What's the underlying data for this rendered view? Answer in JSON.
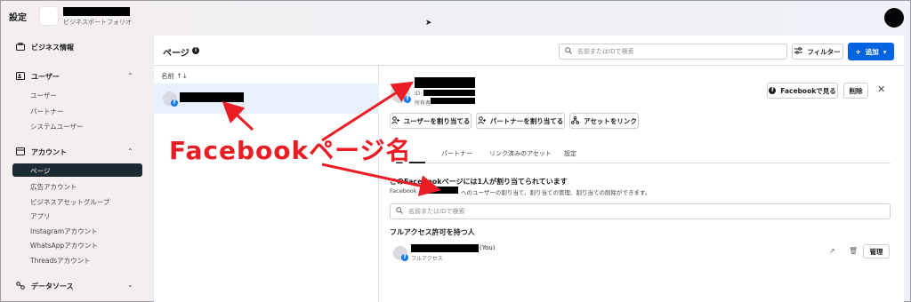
{
  "topbar": {
    "title": "設定",
    "portfolio_label": "ビジネスポートフォリオ"
  },
  "sidebar": {
    "business_info": "ビジネス情報",
    "users_group": "ユーザー",
    "users_items": [
      "ユーザー",
      "パートナー",
      "システムユーザー"
    ],
    "accounts_group": "アカウント",
    "accounts_items": [
      "ページ",
      "広告アカウント",
      "ビジネスアセットグループ",
      "アプリ",
      "Instagramアカウント",
      "WhatsAppアカウント",
      "Threadsアカウント"
    ],
    "datasources_group": "データソース",
    "active_item": "ページ"
  },
  "header": {
    "title": "ページ",
    "search_placeholder": "名前またはIDで検索",
    "filter_label": "フィルター",
    "add_label": "追加"
  },
  "list": {
    "column_header": "名前 ↑↓"
  },
  "detail": {
    "id_label": "ID:",
    "owner_label": "所有者:",
    "view_on_facebook": "Facebookで見る",
    "delete_label": "削除",
    "assign_user": "ユーザーを割り当てる",
    "assign_partner": "パートナーを割り当てる",
    "link_asset": "アセットをリンク",
    "tabs": [
      "パートナー",
      "リンク済みのアセット",
      "設定"
    ],
    "section_title": "このFacebookページには1人が割り当てられています",
    "section_desc_prefix": "Facebook",
    "section_desc_suffix": "へのユーザーの割り当て、割り当ての管理、割り当ての削除ができます。",
    "search_placeholder": "名前またはIDで検索",
    "full_access_heading": "フルアクセス許可を持つ人",
    "person_you": "(You)",
    "person_role": "フルアクセス",
    "manage_label": "管理"
  },
  "annotation": {
    "text": "Facebookページ名",
    "color": "#ea1d24"
  },
  "colors": {
    "primary": "#0064e0",
    "sidebar_active": "#1c2b33",
    "selected_row": "#e7f0fb"
  }
}
